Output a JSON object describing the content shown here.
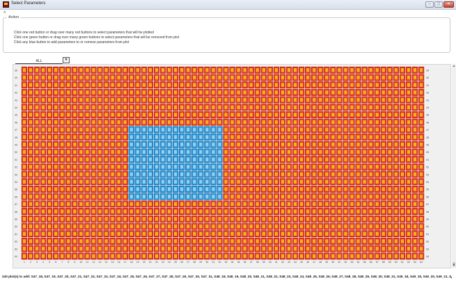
{
  "window": {
    "title": "Select Parameters",
    "controls": {
      "minimize": "–",
      "maximize": "□",
      "close": "✕"
    }
  },
  "collapse_glyph": "^",
  "action": {
    "legend": "Action",
    "instructions": [
      "Click one red button or drag over many red buttons to select parameters that will be plotted",
      "Click one green button or drag over many green buttons to select parameters that will be removed from plot",
      "Click any blue button to add parameters to or remove parameters from plot"
    ]
  },
  "filter": {
    "selected": "ALL",
    "dropdown_icon": "▼"
  },
  "grid": {
    "rows": [
      39,
      40,
      41,
      42,
      43,
      44,
      45,
      46,
      47,
      48,
      49,
      50,
      51,
      52,
      53,
      54,
      55,
      56,
      57,
      58,
      59,
      60,
      61,
      62,
      63,
      64
    ],
    "columns": [
      1,
      2,
      3,
      4,
      5,
      6,
      7,
      8,
      9,
      10,
      11,
      12,
      13,
      14,
      15,
      16,
      17,
      18,
      19,
      20,
      21,
      22,
      23,
      24,
      25,
      26,
      27,
      28,
      29,
      30,
      31,
      32,
      33,
      34,
      35,
      36,
      37,
      38,
      39,
      40,
      41,
      42,
      43,
      44,
      45,
      46,
      47,
      48,
      49,
      50,
      51,
      52,
      53,
      54,
      55,
      56,
      57,
      58,
      59,
      60,
      61,
      62,
      63,
      64
    ],
    "selection": {
      "columns": [
        18,
        32
      ],
      "rows": [
        47,
        56
      ]
    },
    "colors": {
      "red": "#e8301e",
      "red_inner": "#f5b21c",
      "blue": "#1f8fd6",
      "blue_inner": "#8fd0ef"
    }
  },
  "status_text": "240 plot(s) to add: S47_18, S47_19, S47_20, S47_21, S47_22, S47_23, S47_24, S47_25, S47_26, S47_27, S47_28, S47_29, S47_30, S47_31, S48_18, S48_19, S48_20, S48_21, S48_22, S48_23, S48_24, S48_25, S48_26, S48_27, S48_28, S48_29, S48_30, S48_31, S49_18, S49_19, S49_20, S49_21, S49_22, S49_23, S49_24, S49_25, S49_26,",
  "status_marker": "◂"
}
